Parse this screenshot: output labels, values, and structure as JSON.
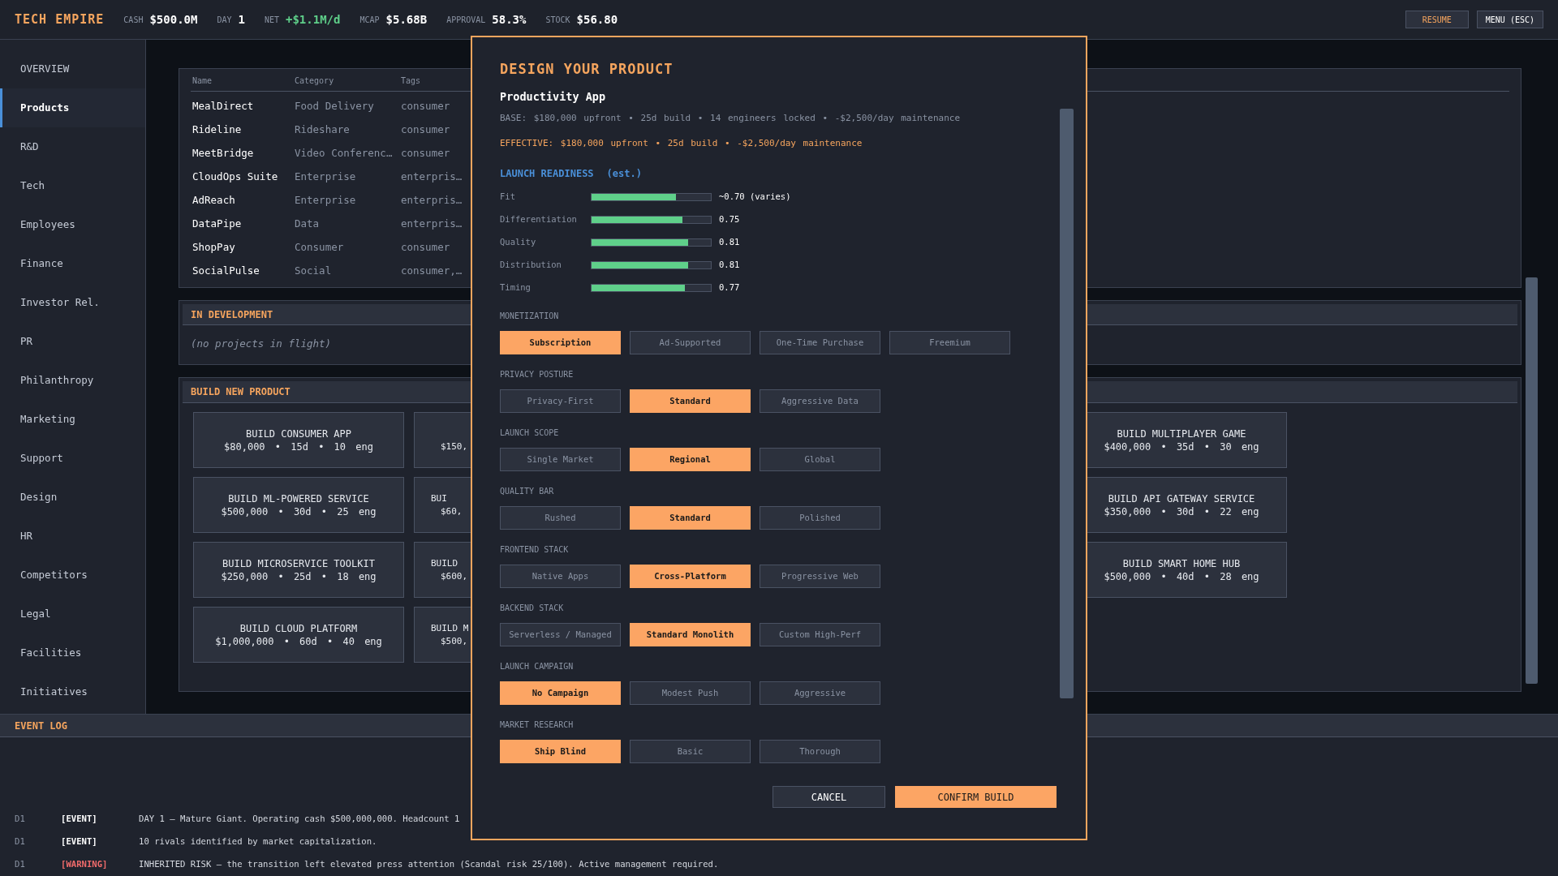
{
  "top_bar": {
    "title": "TECH EMPIRE",
    "stats": [
      {
        "label": "CASH",
        "value": "$500.0M",
        "kind": "plain"
      },
      {
        "label": "DAY",
        "value": "1",
        "kind": "plain"
      },
      {
        "label": "NET",
        "value": "+$1.1M/d",
        "kind": "positive"
      },
      {
        "label": "MCAP",
        "value": "$5.68B",
        "kind": "plain"
      },
      {
        "label": "APPROVAL",
        "value": "58.3%",
        "kind": "plain"
      },
      {
        "label": "STOCK",
        "value": "$56.80",
        "kind": "plain"
      }
    ],
    "buttons": [
      {
        "label": "RESUME",
        "kind": "accent"
      },
      {
        "label": "MENU (ESC)",
        "kind": "plain"
      }
    ]
  },
  "sidebar": {
    "items": [
      {
        "label": "OVERVIEW",
        "selected": false
      },
      {
        "label": "Products",
        "selected": true
      },
      {
        "label": "R&D",
        "selected": false
      },
      {
        "label": "Tech",
        "selected": false
      },
      {
        "label": "Employees",
        "selected": false
      },
      {
        "label": "Finance",
        "selected": false
      },
      {
        "label": "Investor Rel.",
        "selected": false
      },
      {
        "label": "PR",
        "selected": false
      },
      {
        "label": "Philanthropy",
        "selected": false
      },
      {
        "label": "Marketing",
        "selected": false
      },
      {
        "label": "Support",
        "selected": false
      },
      {
        "label": "Design",
        "selected": false
      },
      {
        "label": "HR",
        "selected": false
      },
      {
        "label": "Competitors",
        "selected": false
      },
      {
        "label": "Legal",
        "selected": false
      },
      {
        "label": "Facilities",
        "selected": false
      },
      {
        "label": "Initiatives",
        "selected": false
      }
    ]
  },
  "products_table": {
    "columns": [
      "Name",
      "Category",
      "Tags"
    ],
    "rows": [
      [
        "MealDirect",
        "Food Delivery",
        "consumer"
      ],
      [
        "Rideline",
        "Rideshare",
        "consumer"
      ],
      [
        "MeetBridge",
        "Video Conferenc…",
        "consumer"
      ],
      [
        "CloudOps Suite",
        "Enterprise",
        "enterpris…"
      ],
      [
        "AdReach",
        "Enterprise",
        "enterpris…"
      ],
      [
        "DataPipe",
        "Data",
        "enterpris…"
      ],
      [
        "ShopPay",
        "Consumer",
        "consumer"
      ],
      [
        "SocialPulse",
        "Social",
        "consumer,…"
      ]
    ]
  },
  "in_development": {
    "title": "IN DEVELOPMENT",
    "empty_text": "(no projects in flight)"
  },
  "build_new_product": {
    "title": "BUILD NEW PRODUCT",
    "card_columns": [
      [
        {
          "title": "BUILD CONSUMER APP",
          "cost": "$80,000 • 15d • 10 eng"
        },
        {
          "title": "BUILD ML-POWERED SERVICE",
          "cost": "$500,000 • 30d • 25 eng"
        },
        {
          "title": "BUILD MICROSERVICE TOOLKIT",
          "cost": "$250,000 • 25d • 18 eng"
        },
        {
          "title": "BUILD CLOUD PLATFORM",
          "cost": "$1,000,000 • 60d • 40 eng"
        }
      ],
      [
        {
          "cost": "$150,"
        },
        {
          "title": "BUI",
          "cost": "$60,"
        },
        {
          "title": "BUILD",
          "cost": "$600,"
        },
        {
          "title": "BUILD M",
          "cost": "$500,"
        }
      ],
      [
        {
          "title": "BUILD MULTIPLAYER GAME",
          "cost": "$400,000 • 35d • 30 eng"
        },
        {
          "title": "BUILD API GATEWAY SERVICE",
          "cost": "$350,000 • 30d • 22 eng"
        },
        {
          "title": "BUILD SMART HOME HUB",
          "cost": "$500,000 • 40d • 28 eng"
        }
      ]
    ]
  },
  "event_log": {
    "title": "EVENT LOG",
    "entries": [
      {
        "day": "D1",
        "tag": "[EVENT]",
        "kind": "event",
        "message": "DAY 1 — Mature Giant. Operating cash $500,000,000. Headcount 1"
      },
      {
        "day": "D1",
        "tag": "[EVENT]",
        "kind": "event",
        "message": "10 rivals identified by market capitalization."
      },
      {
        "day": "D1",
        "tag": "[WARNING]",
        "kind": "warning",
        "message": "INHERITED RISK — the transition left elevated press attention (Scandal risk 25/100). Active management required."
      }
    ]
  },
  "modal": {
    "title": "DESIGN YOUR PRODUCT",
    "product": "Productivity App",
    "base_line": "BASE: $180,000 upfront • 25d build • 14 engineers locked • -$2,500/day maintenance",
    "effective_line": "EFFECTIVE: $180,000 upfront • 25d build • -$2,500/day maintenance",
    "readiness": {
      "title": "LAUNCH READINESS",
      "note": "(est.)",
      "metrics": [
        {
          "label": "Fit",
          "level": 0.71,
          "reading": "~0.70 (varies)"
        },
        {
          "label": "Differentiation",
          "level": 0.76,
          "reading": "0.75"
        },
        {
          "label": "Quality",
          "level": 0.81,
          "reading": "0.81"
        },
        {
          "label": "Distribution",
          "level": 0.81,
          "reading": "0.81"
        },
        {
          "label": "Timing",
          "level": 0.78,
          "reading": "0.77"
        }
      ]
    },
    "option_groups": [
      {
        "label": "MONETIZATION",
        "options": [
          {
            "label": "Subscription",
            "selected": true
          },
          {
            "label": "Ad-Supported",
            "selected": false
          },
          {
            "label": "One-Time Purchase",
            "selected": false
          },
          {
            "label": "Freemium",
            "selected": false
          }
        ]
      },
      {
        "label": "PRIVACY POSTURE",
        "options": [
          {
            "label": "Privacy-First",
            "selected": false
          },
          {
            "label": "Standard",
            "selected": true
          },
          {
            "label": "Aggressive Data",
            "selected": false
          }
        ]
      },
      {
        "label": "LAUNCH SCOPE",
        "options": [
          {
            "label": "Single Market",
            "selected": false
          },
          {
            "label": "Regional",
            "selected": true
          },
          {
            "label": "Global",
            "selected": false
          }
        ]
      },
      {
        "label": "QUALITY BAR",
        "options": [
          {
            "label": "Rushed",
            "selected": false
          },
          {
            "label": "Standard",
            "selected": true
          },
          {
            "label": "Polished",
            "selected": false
          }
        ]
      },
      {
        "label": "FRONTEND STACK",
        "options": [
          {
            "label": "Native Apps",
            "selected": false
          },
          {
            "label": "Cross-Platform",
            "selected": true
          },
          {
            "label": "Progressive Web",
            "selected": false
          }
        ]
      },
      {
        "label": "BACKEND STACK",
        "options": [
          {
            "label": "Serverless / Managed",
            "selected": false
          },
          {
            "label": "Standard Monolith",
            "selected": true
          },
          {
            "label": "Custom High-Perf",
            "selected": false
          }
        ]
      },
      {
        "label": "LAUNCH CAMPAIGN",
        "options": [
          {
            "label": "No Campaign",
            "selected": true
          },
          {
            "label": "Modest Push",
            "selected": false
          },
          {
            "label": "Aggressive",
            "selected": false
          }
        ]
      },
      {
        "label": "MARKET RESEARCH",
        "options": [
          {
            "label": "Ship Blind",
            "selected": true
          },
          {
            "label": "Basic",
            "selected": false
          },
          {
            "label": "Thorough",
            "selected": false
          }
        ]
      }
    ],
    "buttons": [
      {
        "label": "CANCEL",
        "kind": "secondary"
      },
      {
        "label": "CONFIRM BUILD",
        "kind": "primary"
      }
    ]
  }
}
